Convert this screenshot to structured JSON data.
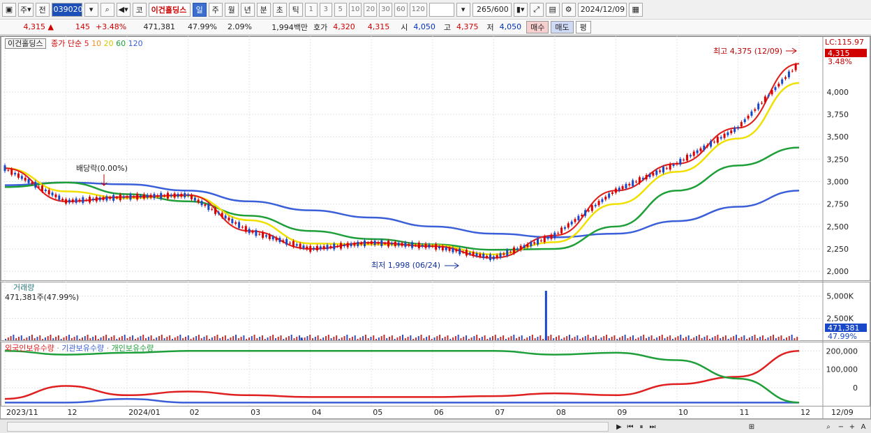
{
  "toolbar": {
    "market_label": "주",
    "prev_label": "전",
    "stock_code": "039020",
    "stock_type": "코",
    "stock_name": "이건홀딩스",
    "periods": [
      "일",
      "주",
      "월",
      "년",
      "분",
      "초",
      "틱"
    ],
    "active_period": "일",
    "intervals": [
      "1",
      "3",
      "5",
      "10",
      "20",
      "30",
      "60",
      "120"
    ],
    "count": "265",
    "count_total": "/600",
    "date": "2024/12/09"
  },
  "quote": {
    "price": "4,315 ▲",
    "change": "145",
    "change_rate": "+3.48%",
    "volume": "471,381",
    "volume_rate": "47.99%",
    "turnover_rate": "2.09%",
    "amount": "1,994백만",
    "bid_label": "호가",
    "ask_price": "4,320",
    "bid_price": "4,315",
    "open_label": "시",
    "open": "4,050",
    "high_label": "고",
    "high": "4,375",
    "low_label": "저",
    "low": "4,050",
    "buy_button": "매수",
    "sell_button": "매도",
    "extra_button": "평"
  },
  "price_pane": {
    "stock_label": "이건홀딩스",
    "ma_title": "종가 단순",
    "ma_periods": [
      "5",
      "10",
      "20",
      "60",
      "120"
    ],
    "ma_colors": [
      "#e02020",
      "#f0901c",
      "#f0e000",
      "#1f9f3a",
      "#3a5fd8"
    ],
    "lc_label": "LC:115.97",
    "last_price_tag": "4,315",
    "last_rate_tag": "3.48%",
    "high_annotation": "최고 4,375 (12/09)",
    "low_annotation": "최저 1,998 (06/24)",
    "dividend_annotation": "배당락(0.00%)",
    "y_ticks": [
      "4,000",
      "3,750",
      "3,500",
      "3,250",
      "3,000",
      "2,750",
      "2,500",
      "2,250",
      "2,000"
    ]
  },
  "volume_pane": {
    "title": "거래량",
    "value_label": "471,381주(47.99%)",
    "y_ticks": [
      "5,000K",
      "2,500K"
    ],
    "last_volume_tag": "471,381",
    "last_rate_tag": "47.99%"
  },
  "holding_pane": {
    "series_names": [
      "외국인보유수량",
      "기관보유수량",
      "개인보유수량"
    ],
    "series_colors": [
      "#e02020",
      "#3a5fd8",
      "#1f9f3a"
    ],
    "y_ticks": [
      "200,000",
      "100,000",
      "0"
    ]
  },
  "x_axis": {
    "labels": [
      "2023/11",
      "12",
      "2024/01",
      "02",
      "03",
      "04",
      "05",
      "06",
      "07",
      "08",
      "09",
      "10",
      "11",
      "12"
    ],
    "right_label": "12/09"
  },
  "chart_data": {
    "type": "line",
    "y_range": [
      1900,
      4450
    ],
    "months": [
      "2023/11",
      "12",
      "2024/01",
      "02",
      "03",
      "04",
      "05",
      "06",
      "07",
      "08",
      "09",
      "10",
      "11",
      "12"
    ],
    "close_monthly_approx": [
      3150,
      2780,
      2830,
      2850,
      2450,
      2250,
      2320,
      2280,
      2150,
      2400,
      2900,
      3200,
      3600,
      4315
    ],
    "ma120_monthly_approx": [
      2960,
      2990,
      2970,
      2900,
      2780,
      2680,
      2600,
      2500,
      2420,
      2380,
      2420,
      2560,
      2720,
      2900
    ],
    "ma60_monthly_approx": [
      2940,
      2990,
      2860,
      2780,
      2620,
      2450,
      2360,
      2300,
      2240,
      2250,
      2500,
      2900,
      3180,
      3380
    ],
    "volume_spikes": [
      {
        "month": "08",
        "value": 5600000
      },
      {
        "month": "04",
        "value": 300000
      }
    ],
    "holding_series": [
      {
        "name": "외국인보유수량",
        "values_approx": [
          -60000,
          10000,
          -40000,
          -20000,
          -40000,
          -50000,
          -50000,
          -50000,
          -45000,
          -30000,
          -40000,
          20000,
          60000,
          200000
        ]
      },
      {
        "name": "기관보유수량",
        "values_approx": [
          -80000,
          -80000,
          -60000,
          -80000,
          -80000,
          -80000,
          -80000,
          -80000,
          -80000,
          -80000,
          -80000,
          -80000,
          -80000,
          -80000
        ]
      },
      {
        "name": "개인보유수량",
        "values_approx": [
          200000,
          180000,
          190000,
          200000,
          200000,
          200000,
          200000,
          200000,
          200000,
          180000,
          190000,
          150000,
          50000,
          -80000
        ]
      }
    ]
  }
}
